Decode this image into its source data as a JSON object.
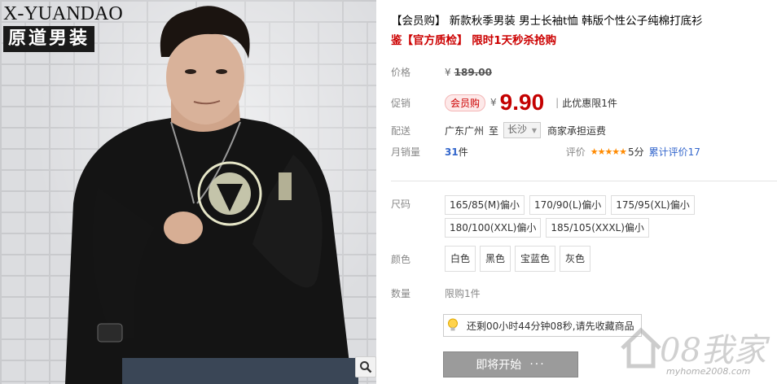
{
  "brand": {
    "en": "X-YUANDAO",
    "cn": "原道男装"
  },
  "product": {
    "title": "【会员购】 新款秋季男装 男士长袖t恤 韩版个性公子纯棉打底衫",
    "subtitle": "鉴【官方质检】 限时1天秒杀抢购"
  },
  "price": {
    "label": "价格",
    "currency": "¥",
    "original": "189.00"
  },
  "promo": {
    "label": "促销",
    "tag": "会员购",
    "currency": "¥",
    "value": "9.90",
    "separator": "|",
    "note": "此优惠限1件"
  },
  "shipping": {
    "label": "配送",
    "from": "广东广州",
    "to_word": "至",
    "destination": "长沙",
    "arrow": "▼",
    "fee": "商家承担运费"
  },
  "sales": {
    "label": "月销量",
    "count": "31",
    "unit": "件",
    "rating_label": "评价",
    "stars": "★★★★★",
    "score": "5分",
    "reviews": "累计评价17"
  },
  "size": {
    "label": "尺码",
    "options": [
      "165/85(M)偏小",
      "170/90(L)偏小",
      "175/95(XL)偏小",
      "180/100(XXL)偏小",
      "185/105(XXXL)偏小"
    ]
  },
  "color": {
    "label": "颜色",
    "options": [
      "白色",
      "黑色",
      "宝蓝色",
      "灰色"
    ]
  },
  "quantity": {
    "label": "数量",
    "limit": "限购1件"
  },
  "countdown": {
    "text": "还剩00小时44分钟08秒,请先收藏商品",
    "icon": "lightbulb-icon"
  },
  "buy": {
    "label": "即将开始",
    "dots": "···"
  },
  "watermark": {
    "logo": "08我家",
    "url": "myhome2008.com"
  },
  "colors": {
    "accent": "#c40000",
    "link": "#3366cc",
    "button": "#9b9b9b"
  }
}
